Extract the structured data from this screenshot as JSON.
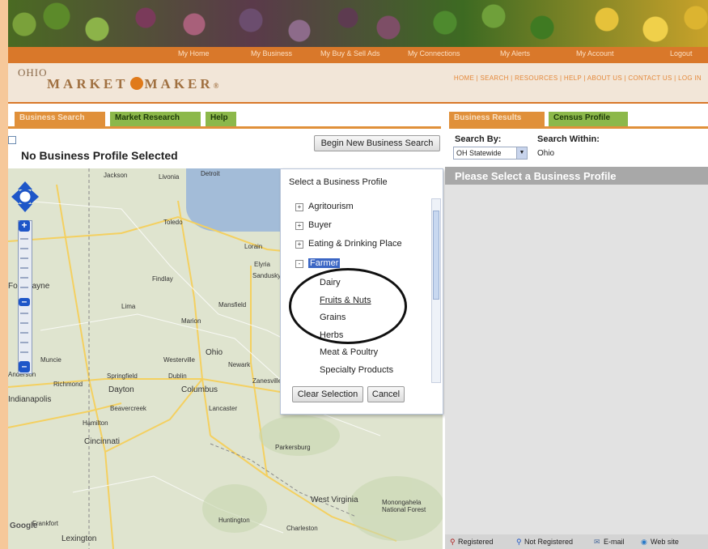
{
  "topnav": {
    "items": [
      "My Home",
      "My Business",
      "My Buy & Sell Ads",
      "My Connections",
      "My Alerts",
      "My Account",
      "Logout"
    ]
  },
  "logo": {
    "line1": "OHIO",
    "line2_left": "MARKET",
    "line2_right": "MAKER",
    "mark": "®"
  },
  "subnav": {
    "text": "HOME  |  SEARCH  |  RESOURCES  |  HELP  |  ABOUT US  |  CONTACT US  |  LOG IN"
  },
  "tabs": {
    "business_search": "Business Search",
    "market_research": "Market Research",
    "help": "Help",
    "business_results": "Business Results",
    "census_profile": "Census Profile"
  },
  "left": {
    "no_profile": "No Business Profile Selected",
    "new_search_button": "Begin New Business Search"
  },
  "map_labels": {
    "jackson": "Jackson",
    "livonia": "Livonia",
    "detroit": "Detroit",
    "toledo": "Toledo",
    "fort_wayne": "Fort Wayne",
    "findlay": "Findlay",
    "lima": "Lima",
    "marion": "Marion",
    "mansfield": "Mansfield",
    "ohio": "Ohio",
    "newark": "Newark",
    "columbus": "Columbus",
    "dayton": "Dayton",
    "springfield": "Springfield",
    "dublin": "Dublin",
    "lancaster": "Lancaster",
    "cincinnati": "Cincinnati",
    "hamilton": "Hamilton",
    "parkersburg": "Parkersburg",
    "west_virginia": "West Virginia",
    "huntington": "Huntington",
    "charleston": "Charleston",
    "indianapolis": "Indianapolis",
    "richmond": "Richmond",
    "muncie": "Muncie",
    "anderson": "Anderson",
    "lexington": "Lexington",
    "frankfort": "Frankfort",
    "lorain": "Lorain",
    "elyria": "Elyria",
    "sandusky": "Sandusky",
    "monongahela": "Monongahela National Forest",
    "beavercreek": "Beavercreek",
    "westerville": "Westerville",
    "zanesville": "Zanesville",
    "google": "Google"
  },
  "popup": {
    "title": "Select a Business Profile",
    "items": [
      {
        "label": "Agritourism",
        "expander": "+"
      },
      {
        "label": "Buyer",
        "expander": "+"
      },
      {
        "label": "Eating & Drinking Place",
        "expander": "+"
      },
      {
        "label": "Farmer",
        "expander": "-"
      },
      {
        "label": "Dairy"
      },
      {
        "label": "Fruits & Nuts"
      },
      {
        "label": "Grains"
      },
      {
        "label": "Herbs"
      },
      {
        "label": "Meat & Poultry"
      },
      {
        "label": "Specialty Products"
      }
    ],
    "clear_button": "Clear Selection",
    "cancel_button": "Cancel"
  },
  "right": {
    "search_by_label": "Search By:",
    "search_within_label": "Search Within:",
    "search_by_value": "OH Statewide",
    "search_within_value": "Ohio",
    "please_select": "Please Select a Business Profile"
  },
  "legend": {
    "registered": "Registered",
    "not_registered": "Not Registered",
    "email": "E-mail",
    "website": "Web site"
  },
  "colors": {
    "orange": "#e0903a",
    "green": "#8cb84a",
    "select_blue": "#3b66c4",
    "zoom_blue": "#1e56c8"
  }
}
